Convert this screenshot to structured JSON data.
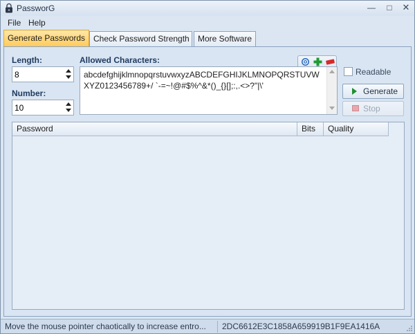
{
  "window": {
    "title": "PassworG"
  },
  "menu": {
    "file": "File",
    "help": "Help"
  },
  "tabs": [
    {
      "label": "Generate Passwords",
      "active": true
    },
    {
      "label": "Check Password Strength",
      "active": false
    },
    {
      "label": "More Software",
      "active": false
    }
  ],
  "generate": {
    "length_label": "Length:",
    "length_value": "8",
    "number_label": "Number:",
    "number_value": "10",
    "allowed_label": "Allowed Characters:",
    "allowed_chars": "abcdefghijklmnopqrstuvwxyzABCDEFGHIJKLMNOPQRSTUVWXYZ0123456789+/ `-=~!@#$%^&*()_{}[];:,.<>?\"|\\'",
    "readable_label": "Readable",
    "readable_checked": false,
    "generate_label": "Generate",
    "stop_label": "Stop"
  },
  "list": {
    "columns": [
      "Password",
      "Bits",
      "Quality"
    ],
    "rows": []
  },
  "status": {
    "message": "Move the mouse pointer chaotically to increase entro...",
    "hash": "2DC6612E3C1858A659919B1F9EA1416A"
  },
  "colors": {
    "active_tab": "#ffcb5c",
    "panel": "#d9e5f2",
    "play": "#1f8f2e"
  },
  "icons": [
    "app-lock-icon",
    "gear-icon",
    "add-icon",
    "remove-icon",
    "play-icon",
    "stop-icon"
  ]
}
